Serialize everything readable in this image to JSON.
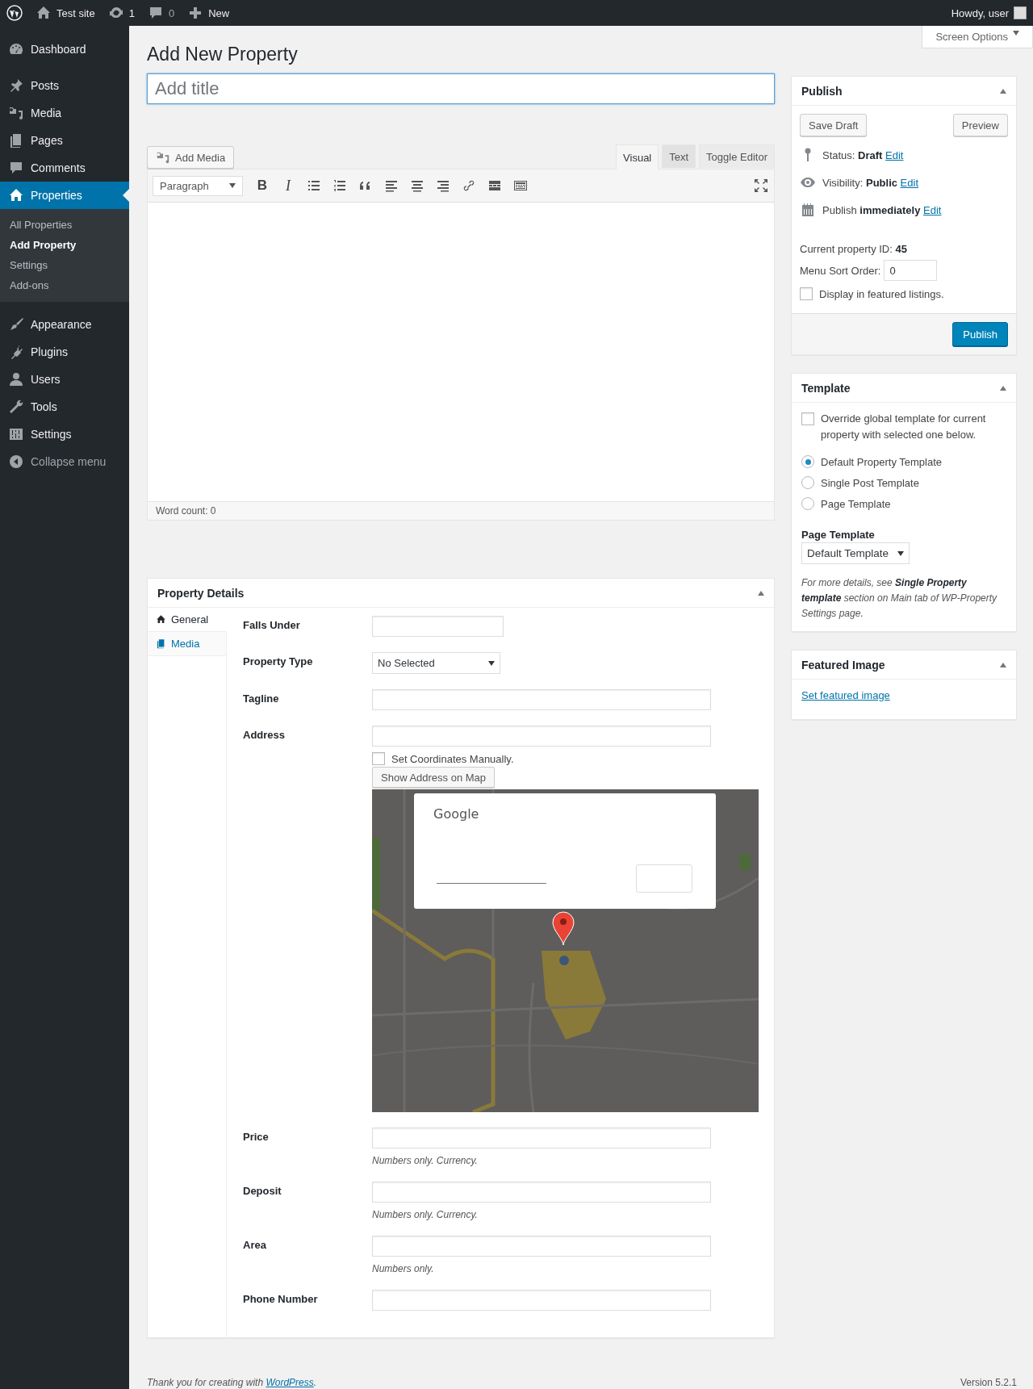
{
  "admin_bar": {
    "site": "Test site",
    "updates": "1",
    "comments": "0",
    "new": "New",
    "greeting": "Howdy, user"
  },
  "sidebar": {
    "items": [
      {
        "label": "Dashboard",
        "selected": false
      },
      {
        "label": "Posts",
        "selected": false
      },
      {
        "label": "Media",
        "selected": false
      },
      {
        "label": "Pages",
        "selected": false
      },
      {
        "label": "Comments",
        "selected": false
      },
      {
        "label": "Properties",
        "selected": true,
        "children": [
          {
            "label": "All Properties",
            "selected": false
          },
          {
            "label": "Add Property",
            "selected": true
          },
          {
            "label": "Settings",
            "selected": false
          },
          {
            "label": "Add-ons",
            "selected": false
          }
        ]
      },
      {
        "label": "Appearance",
        "selected": false
      },
      {
        "label": "Plugins",
        "selected": false
      },
      {
        "label": "Users",
        "selected": false
      },
      {
        "label": "Tools",
        "selected": false
      },
      {
        "label": "Settings",
        "selected": false
      }
    ],
    "collapse": "Collapse menu"
  },
  "screen_options": "Screen Options",
  "page_title": "Add New Property",
  "title_field": {
    "placeholder": "Add title"
  },
  "editor": {
    "add_media": "Add Media",
    "tabs": [
      {
        "label": "Visual",
        "selected": true
      },
      {
        "label": "Text",
        "selected": false
      }
    ],
    "toggle": "Toggle Editor",
    "format": "Paragraph",
    "bold_glyph": "B",
    "italic_glyph": "I",
    "word_count": "Word count: 0"
  },
  "property_details": {
    "title": "Property Details",
    "tabs": [
      {
        "label": "General",
        "selected": true
      },
      {
        "label": "Media",
        "selected": false
      }
    ],
    "fields": [
      {
        "kind": "short",
        "label": "Falls Under"
      },
      {
        "kind": "select",
        "label": "Property Type",
        "value": "No Selected"
      },
      {
        "kind": "text",
        "label": "Tagline"
      },
      {
        "kind": "address",
        "label": "Address",
        "checkbox": "Set Coordinates Manually.",
        "checked": false,
        "button": "Show Address on Map",
        "map_dialog": {
          "title": "Google"
        }
      },
      {
        "kind": "text",
        "label": "Price",
        "hint": "Numbers only. Currency."
      },
      {
        "kind": "text",
        "label": "Deposit",
        "hint": "Numbers only. Currency."
      },
      {
        "kind": "text",
        "label": "Area",
        "hint": "Numbers only."
      },
      {
        "kind": "text",
        "label": "Phone Number"
      }
    ]
  },
  "publish": {
    "title": "Publish",
    "save_draft": "Save Draft",
    "preview": "Preview",
    "rows": [
      {
        "kind": "status",
        "label": "Status:",
        "value": "Draft",
        "link": "Edit"
      },
      {
        "kind": "visibility",
        "label": "Visibility:",
        "value": "Public",
        "link": "Edit"
      },
      {
        "kind": "schedule",
        "label": "Publish",
        "value": "immediately",
        "link": "Edit"
      }
    ],
    "property_id_label": "Current property ID:",
    "property_id": "45",
    "sort_label": "Menu Sort Order:",
    "sort_value": "0",
    "featured": {
      "label": "Display in featured listings.",
      "checked": false
    },
    "button": "Publish"
  },
  "template": {
    "title": "Template",
    "override": {
      "label": "Override global template for current property with selected one below.",
      "checked": false
    },
    "options": [
      {
        "label": "Default Property Template",
        "selected": true
      },
      {
        "label": "Single Post Template",
        "selected": false
      },
      {
        "label": "Page Template",
        "selected": false
      }
    ],
    "page_template_label": "Page Template",
    "page_template": "Default Template",
    "note": "For more details, see **Single Property template** section on Main tab of WP-Property Settings page."
  },
  "featured_image": {
    "title": "Featured Image",
    "link": "Set featured image"
  },
  "footer": {
    "text": "Thank you for creating with",
    "link": "WordPress",
    "after": ".",
    "version": "Version 5.2.1"
  }
}
